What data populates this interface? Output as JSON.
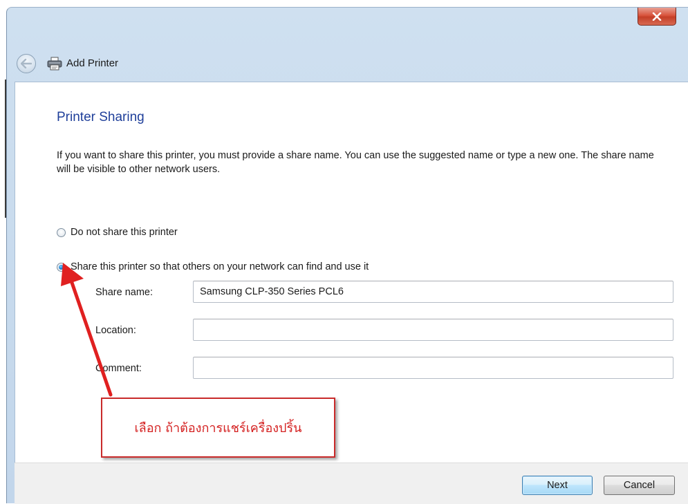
{
  "window": {
    "title": "Add Printer",
    "close_label": "x"
  },
  "page": {
    "heading": "Printer Sharing",
    "description": "If you want to share this printer, you must provide a share name. You can use the suggested name or type a new one. The share name will be visible to other network users."
  },
  "options": {
    "no_share_label": "Do not share this printer",
    "share_label": "Share this printer so that others on your network can find and use it",
    "selected": "share"
  },
  "form": {
    "share_name_label": "Share name:",
    "share_name_value": "Samsung CLP-350 Series PCL6",
    "location_label": "Location:",
    "location_value": "",
    "comment_label": "Comment:",
    "comment_value": ""
  },
  "annotation": {
    "text": "เลือก ถ้าต้องการแชร์เครื่องปริ้น",
    "color": "#d42020"
  },
  "buttons": {
    "next_label": "Next",
    "cancel_label": "Cancel"
  },
  "icons": {
    "back": "back-arrow-icon",
    "printer": "printer-icon",
    "close": "close-icon"
  }
}
